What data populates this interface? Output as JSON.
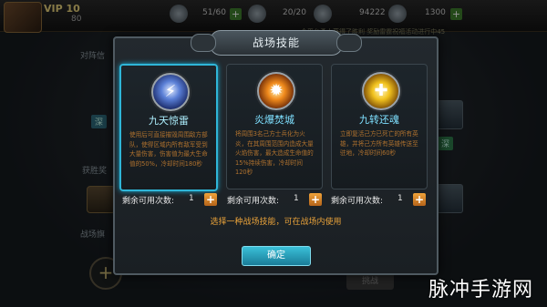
{
  "hud": {
    "vip_label": "VIP 10",
    "level": "80",
    "resource1": "51/60",
    "resource2": "20/20",
    "gold": "94222",
    "gems": "1300",
    "scroll_text": "全平台勇士获得了胜利 奖励雷霆祝福活动进行中45"
  },
  "dialog": {
    "title": "战场技能",
    "skills": [
      {
        "name": "九天惊雷",
        "description": "使用后可直接摧毁周围敌方部队，使得区域内所有敌军受到大量伤害，伤害值为最大生命值的50%，冷却时间180秒",
        "icon": "thunder-icon",
        "selected": true
      },
      {
        "name": "炎爆焚城",
        "description": "将周围3名己方士兵化为火炎，在其周围范围内造成大量火焰伤害，最大造成生命值的15%持续伤害，冷却时间120秒",
        "icon": "fire-icon",
        "selected": false
      },
      {
        "name": "九转还魂",
        "description": "立即复活己方已死亡的所有英雄，并将己方所有英雄传送至驻地，冷却时间60秒",
        "icon": "revive-icon",
        "selected": false
      }
    ],
    "count_label": "剩余可用次数:",
    "counts": [
      "1",
      "1",
      "1"
    ],
    "hint": "选择一种战场技能，可在战场内使用",
    "confirm_label": "确定"
  },
  "background": {
    "left_labels": [
      "对阵信",
      "获胜奖",
      "战场旗"
    ],
    "left_chip": "深",
    "right_chip": "深",
    "bottom_button": "挑战"
  },
  "watermark": "脉冲手游网"
}
